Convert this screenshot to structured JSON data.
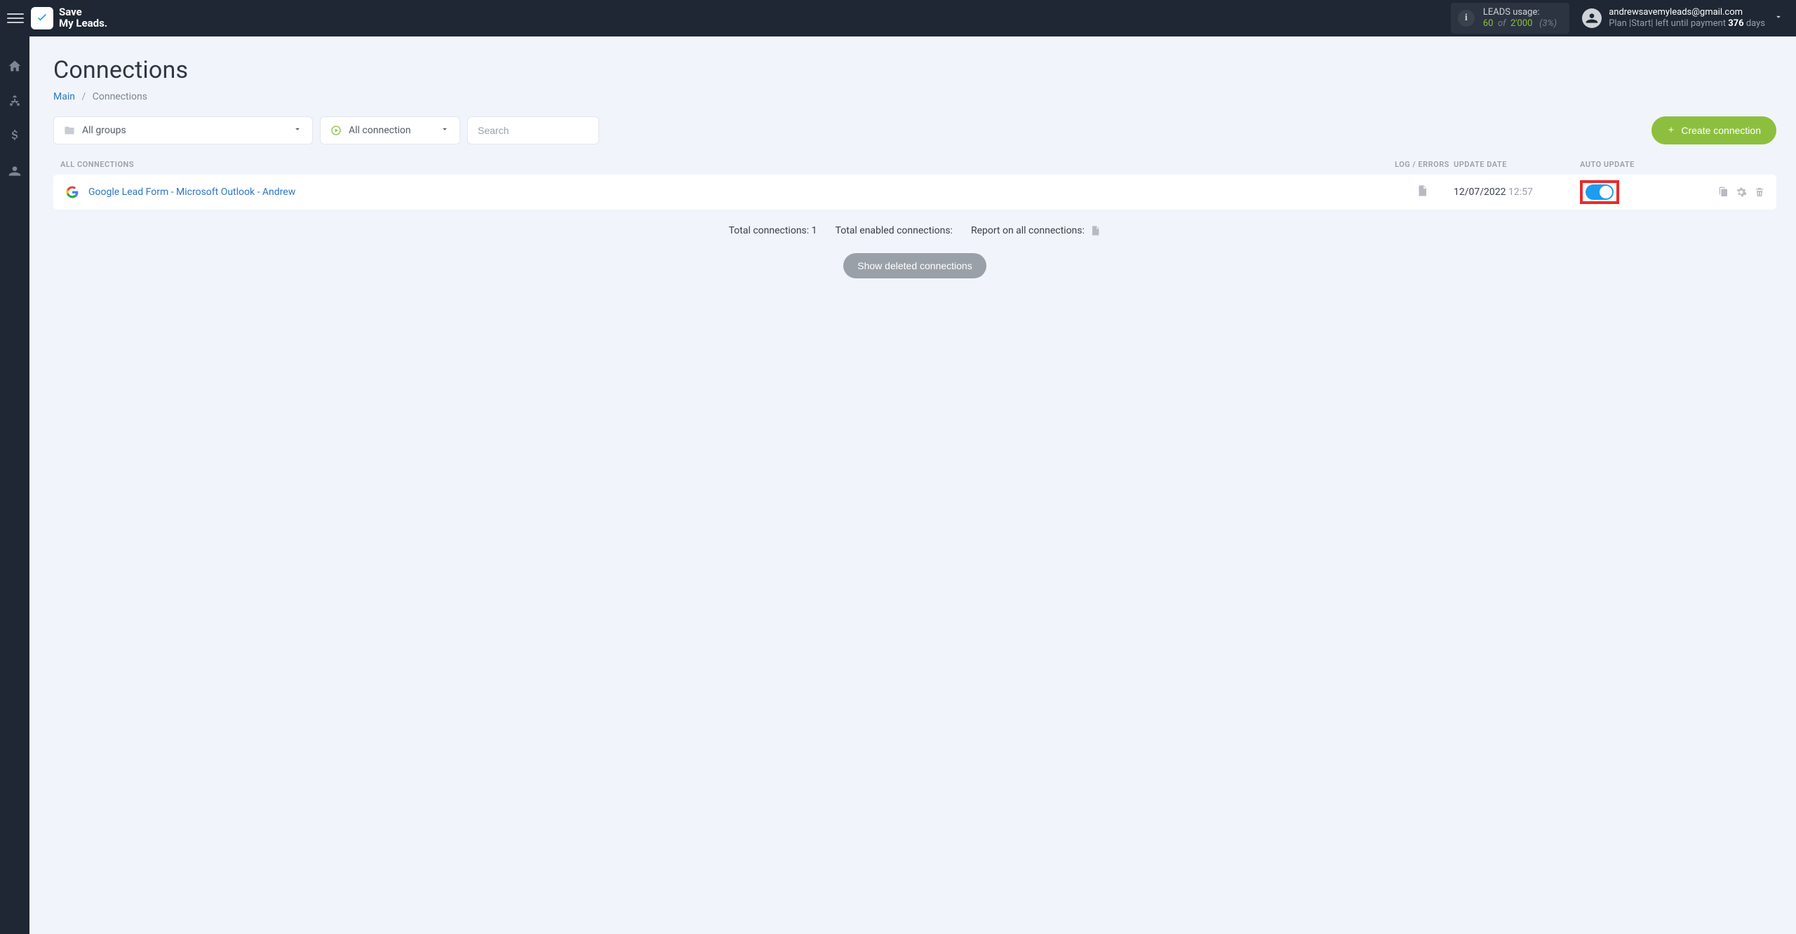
{
  "brand": {
    "line1": "Save",
    "line2": "My Leads."
  },
  "usage": {
    "label": "LEADS usage:",
    "used": "60",
    "of_word": "of",
    "limit": "2'000",
    "pct": "(3%)"
  },
  "account": {
    "email": "andrewsavemyleads@gmail.com",
    "plan_prefix": "Plan |Start| left until payment",
    "days_num": "376",
    "days_word": "days"
  },
  "page": {
    "title": "Connections",
    "breadcrumb_main": "Main",
    "breadcrumb_current": "Connections"
  },
  "filters": {
    "groups_label": "All groups",
    "conn_label": "All connection",
    "search_placeholder": "Search"
  },
  "buttons": {
    "create": "Create connection",
    "show_deleted": "Show deleted connections"
  },
  "headers": {
    "all": "ALL CONNECTIONS",
    "log": "LOG / ERRORS",
    "update": "UPDATE DATE",
    "auto": "AUTO UPDATE"
  },
  "rows": [
    {
      "name": "Google Lead Form - Microsoft Outlook - Andrew",
      "date": "12/07/2022",
      "time": "12:57",
      "auto_update": true
    }
  ],
  "summary": {
    "total_label": "Total connections:",
    "total_value": "1",
    "enabled_label": "Total enabled connections:",
    "enabled_value": "",
    "report_label": "Report on all connections:"
  }
}
